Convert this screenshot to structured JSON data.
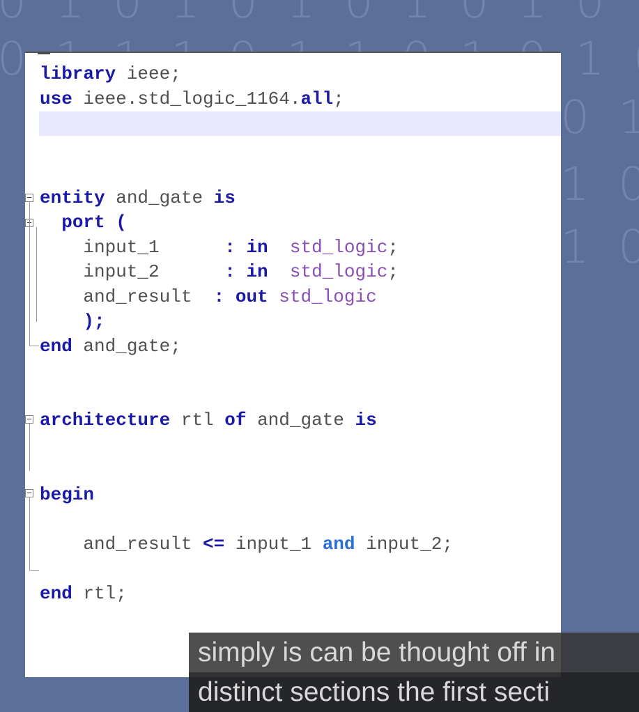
{
  "background_digits": [
    "0 1 0 1 0 1   0 1 0 1 0 1 0 1 0 1 0 1 0",
    "0 1 1 1 0 1  1 0 1 0 1 0 1 0 1 1 0",
    "0 1",
    "1 0",
    "1 0"
  ],
  "code_lines": [
    [
      {
        "t": "library",
        "c": "kw"
      },
      {
        "t": " ieee;",
        "c": "pl"
      }
    ],
    [
      {
        "t": "use",
        "c": "kw"
      },
      {
        "t": " ieee.std_logic_1164.",
        "c": "pl"
      },
      {
        "t": "all",
        "c": "kw"
      },
      {
        "t": ";",
        "c": "pl"
      }
    ],
    [],
    [],
    [],
    [
      {
        "t": "entity",
        "c": "kw"
      },
      {
        "t": " and_gate ",
        "c": "pl"
      },
      {
        "t": "is",
        "c": "kw"
      }
    ],
    [
      {
        "t": "  ",
        "c": "pl"
      },
      {
        "t": "port (",
        "c": "kw"
      }
    ],
    [
      {
        "t": "    input_1      ",
        "c": "pl"
      },
      {
        "t": ": in  ",
        "c": "kw"
      },
      {
        "t": "std_logic",
        "c": "ty"
      },
      {
        "t": ";",
        "c": "pl"
      }
    ],
    [
      {
        "t": "    input_2      ",
        "c": "pl"
      },
      {
        "t": ": in  ",
        "c": "kw"
      },
      {
        "t": "std_logic",
        "c": "ty"
      },
      {
        "t": ";",
        "c": "pl"
      }
    ],
    [
      {
        "t": "    and_result  ",
        "c": "pl"
      },
      {
        "t": ": out ",
        "c": "kw"
      },
      {
        "t": "std_logic",
        "c": "ty"
      }
    ],
    [
      {
        "t": "    );",
        "c": "kw"
      }
    ],
    [
      {
        "t": "end",
        "c": "kw"
      },
      {
        "t": " and_gate;",
        "c": "pl"
      }
    ],
    [],
    [],
    [
      {
        "t": "architecture",
        "c": "kw"
      },
      {
        "t": " rtl ",
        "c": "pl"
      },
      {
        "t": "of",
        "c": "kw"
      },
      {
        "t": " and_gate ",
        "c": "pl"
      },
      {
        "t": "is",
        "c": "kw"
      }
    ],
    [],
    [],
    [
      {
        "t": "begin",
        "c": "kw"
      }
    ],
    [],
    [
      {
        "t": "    and_result ",
        "c": "pl"
      },
      {
        "t": "<=",
        "c": "kw"
      },
      {
        "t": " input_1 ",
        "c": "pl"
      },
      {
        "t": "and",
        "c": "kw2"
      },
      {
        "t": " input_2;",
        "c": "pl"
      }
    ],
    [],
    [
      {
        "t": "end",
        "c": "kw"
      },
      {
        "t": " rtl;",
        "c": "pl"
      }
    ]
  ],
  "caption": {
    "line1": "simply is can be thought off in",
    "line2": "distinct sections the first secti"
  },
  "colors": {
    "keyword": "#1a1aa6",
    "type": "#8a4fb5",
    "plain": "#505050",
    "keyword_and": "#2e6fd6"
  }
}
